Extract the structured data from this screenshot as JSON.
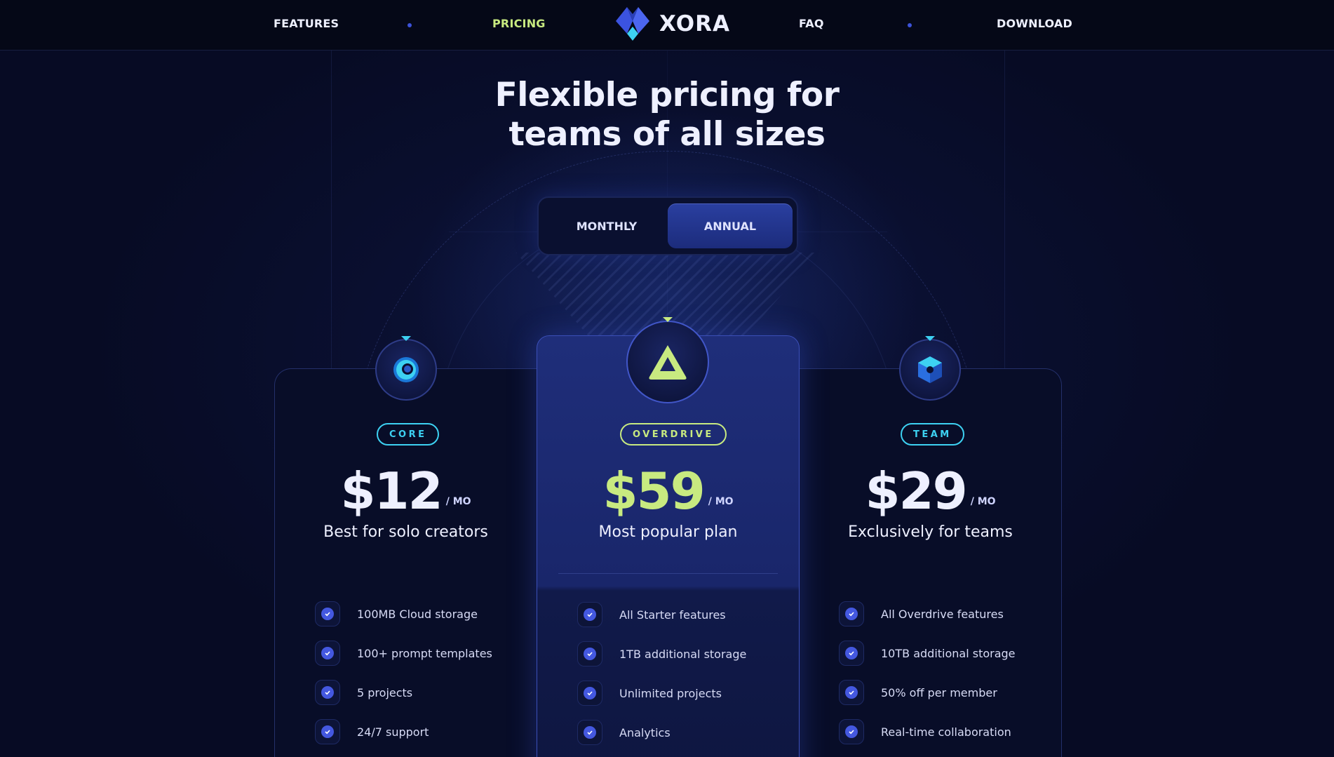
{
  "nav": {
    "links": [
      {
        "label": "FEATURES"
      },
      {
        "label": "PRICING",
        "active": true
      },
      {
        "label": "FAQ"
      },
      {
        "label": "DOWNLOAD"
      }
    ],
    "logo_text": "XORA"
  },
  "hero": {
    "title_line1": "Flexible pricing for",
    "title_line2": "teams of all sizes"
  },
  "billing_toggle": {
    "monthly_label": "MONTHLY",
    "annual_label": "ANNUAL",
    "selected": "ANNUAL"
  },
  "plans": [
    {
      "badge": "CORE",
      "price": "$12",
      "per": "/ MO",
      "subtitle": "Best for solo creators",
      "features": [
        "100MB Cloud storage",
        "100+ prompt templates",
        "5 projects",
        "24/7 support"
      ]
    },
    {
      "badge": "OVERDRIVE",
      "price": "$59",
      "per": "/ MO",
      "subtitle": "Most popular plan",
      "features": [
        "All Starter features",
        "1TB additional storage",
        "Unlimited projects",
        "Analytics"
      ]
    },
    {
      "badge": "TEAM",
      "price": "$29",
      "per": "/ MO",
      "subtitle": "Exclusively for teams",
      "features": [
        "All Overdrive features",
        "10TB additional storage",
        "50% off per member",
        "Real-time collaboration"
      ]
    }
  ],
  "icons": {
    "logo": "xora-diamond-logo-icon",
    "core": "ring-orb-icon",
    "overdrive": "triangle-icon",
    "team": "hexagon-cube-icon",
    "check": "check-circle-icon"
  },
  "colors": {
    "background": "#070b24",
    "accent_lime": "#c8ea80",
    "accent_cyan": "#3dd1f2",
    "accent_blue": "#4458e0"
  }
}
